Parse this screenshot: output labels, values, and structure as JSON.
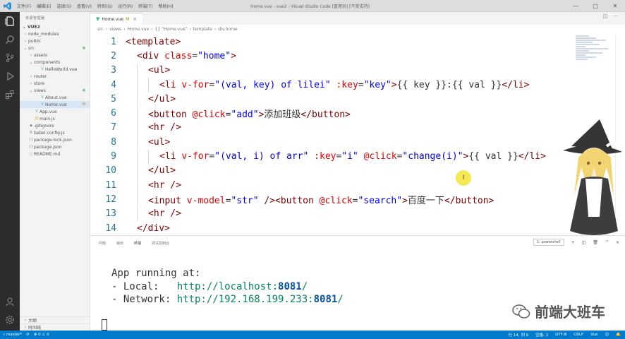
{
  "titlebar": {
    "menu": [
      "文件(F)",
      "编辑(E)",
      "选择(S)",
      "查看(V)",
      "转到(G)",
      "运行(R)",
      "终端(T)",
      "帮助(H)"
    ],
    "window_title": "Home.vue - vue2 - Visual Studio Code [管理员] [不受支持]"
  },
  "sidebar": {
    "header": "资源管理器",
    "section": "VUE2",
    "tree": [
      {
        "label": "node_modules",
        "arrow": "›",
        "icon": "",
        "depth": 0
      },
      {
        "label": "public",
        "arrow": "›",
        "icon": "",
        "depth": 0
      },
      {
        "label": "src",
        "arrow": "⌄",
        "icon": "",
        "depth": 0,
        "mark": "●"
      },
      {
        "label": "assets",
        "arrow": "›",
        "icon": "",
        "depth": 1
      },
      {
        "label": "components",
        "arrow": "⌄",
        "icon": "",
        "depth": 1
      },
      {
        "label": "HelloWorld.vue",
        "arrow": "",
        "icon": "V",
        "depth": 2
      },
      {
        "label": "router",
        "arrow": "›",
        "icon": "",
        "depth": 1
      },
      {
        "label": "store",
        "arrow": "›",
        "icon": "",
        "depth": 1
      },
      {
        "label": "views",
        "arrow": "⌄",
        "icon": "",
        "depth": 1,
        "mark": "●"
      },
      {
        "label": "About.vue",
        "arrow": "",
        "icon": "V",
        "depth": 2
      },
      {
        "label": "Home.vue",
        "arrow": "",
        "icon": "V",
        "depth": 2,
        "mark": "M",
        "active": true
      },
      {
        "label": "App.vue",
        "arrow": "",
        "icon": "V",
        "depth": 1
      },
      {
        "label": "main.js",
        "arrow": "",
        "icon": "JS",
        "depth": 1
      },
      {
        "label": ".gitignore",
        "arrow": "",
        "icon": "◆",
        "depth": 0
      },
      {
        "label": "babel.config.js",
        "arrow": "",
        "icon": "B",
        "depth": 0
      },
      {
        "label": "package-lock.json",
        "arrow": "",
        "icon": "{}",
        "depth": 0
      },
      {
        "label": "package.json",
        "arrow": "",
        "icon": "{}",
        "depth": 0
      },
      {
        "label": "README.md",
        "arrow": "",
        "icon": "ⓘ",
        "depth": 0
      }
    ],
    "bottom": [
      "大纲",
      "时间线"
    ]
  },
  "editor": {
    "tab_label": "Home.vue",
    "tab_modified": "M",
    "breadcrumb": [
      "src",
      "views",
      "Home.vue",
      "{} \"Home.vue\"",
      "template",
      "div.home"
    ],
    "lines": [
      {
        "n": "1",
        "indent": 0,
        "html": "<span class=\"t\">&lt;template&gt;</span>"
      },
      {
        "n": "2",
        "indent": 1,
        "html": "<span class=\"t\">&lt;div</span> <span class=\"a\">class</span>=<span class=\"s\">\"home\"</span><span class=\"t\">&gt;</span>"
      },
      {
        "n": "3",
        "indent": 2,
        "html": "<span class=\"t\">&lt;ul&gt;</span>"
      },
      {
        "n": "4",
        "indent": 3,
        "html": "<span class=\"t\">&lt;li</span> <span class=\"a\">v-for</span>=<span class=\"s\">\"(val, key) of lilei\"</span> <span class=\"a\">:key</span>=<span class=\"s\">\"key\"</span><span class=\"t\">&gt;</span>{{ key }}:{{ val }}<span class=\"t\">&lt;/li&gt;</span>"
      },
      {
        "n": "5",
        "indent": 2,
        "html": "<span class=\"t\">&lt;/ul&gt;</span>"
      },
      {
        "n": "6",
        "indent": 2,
        "html": "<span class=\"t\">&lt;button</span> <span class=\"a\">@click</span>=<span class=\"s\">\"add\"</span><span class=\"t\">&gt;</span>添加班级<span class=\"t\">&lt;/button&gt;</span>"
      },
      {
        "n": "7",
        "indent": 2,
        "html": "<span class=\"t\">&lt;hr /&gt;</span>"
      },
      {
        "n": "8",
        "indent": 2,
        "html": "<span class=\"t\">&lt;ul&gt;</span>"
      },
      {
        "n": "9",
        "indent": 3,
        "html": "<span class=\"t\">&lt;li</span> <span class=\"a\">v-for</span>=<span class=\"s\">\"(val, i) of arr\"</span> <span class=\"a\">:key</span>=<span class=\"s\">\"i\"</span> <span class=\"a\">@click</span>=<span class=\"s\">\"change(i)\"</span><span class=\"t\">&gt;</span>{{ val }}<span class=\"t\">&lt;/li&gt;</span>"
      },
      {
        "n": "10",
        "indent": 2,
        "html": "<span class=\"t\">&lt;/ul&gt;</span>"
      },
      {
        "n": "11",
        "indent": 2,
        "html": "<span class=\"t\">&lt;hr /&gt;</span>"
      },
      {
        "n": "12",
        "indent": 2,
        "html": "<span class=\"t\">&lt;input</span> <span class=\"a\">v-model</span>=<span class=\"s\">\"str\"</span> <span class=\"t\">/&gt;&lt;button</span> <span class=\"a\">@click</span>=<span class=\"s\">\"search\"</span><span class=\"t\">&gt;</span>百度一下<span class=\"t\">&lt;/button&gt;</span>"
      },
      {
        "n": "13",
        "indent": 2,
        "html": "<span class=\"t\">&lt;hr /&gt;</span>"
      },
      {
        "n": "14",
        "indent": 1,
        "html": "<span class=\"t\">&lt;/div&gt;</span>"
      }
    ]
  },
  "panel": {
    "tabs": [
      "问题",
      "输出",
      "终端",
      "调试控制台"
    ],
    "active_tab": "终端",
    "terminal_select": "1: powershell",
    "terminal": {
      "heading": "App running at:",
      "local_label": "- Local:   ",
      "local_url": "http://localhost:",
      "local_port": "8081",
      "network_label": "- Network: ",
      "network_url": "http://192.168.199.233:",
      "network_port": "8081"
    },
    "watermark": "前端大班车"
  },
  "statusbar": {
    "left": [
      "⑂ master*",
      "⟳",
      "⊗ 0 ⚠ 0"
    ],
    "right": [
      "行 14, 列 9",
      "空格: 2",
      "UTF-8",
      "CRLF",
      "Vue",
      "☺",
      "🔔"
    ]
  },
  "colors": {
    "statusbar": "#007acc",
    "activitybar": "#2c2c2c",
    "tag": "#800000",
    "attr": "#e50000",
    "string": "#0000ff"
  }
}
